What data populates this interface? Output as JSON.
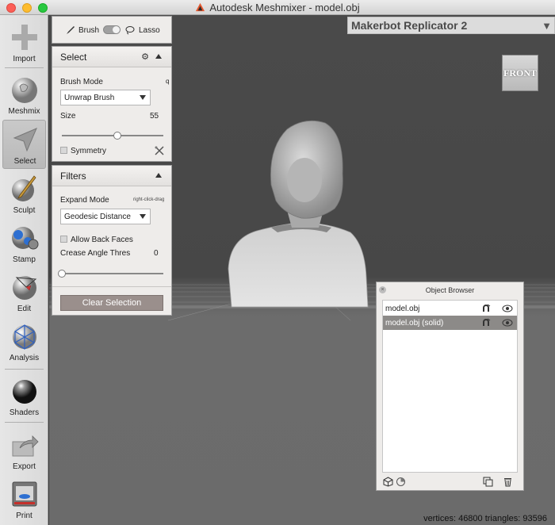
{
  "window": {
    "title": "Autodesk Meshmixer - model.obj"
  },
  "toolbar": {
    "items": [
      {
        "label": "Import",
        "icon": "plus-icon"
      },
      {
        "label": "Meshmix",
        "icon": "meshmix-bunny-icon"
      },
      {
        "label": "Select",
        "icon": "select-arrow-icon",
        "active": true
      },
      {
        "label": "Sculpt",
        "icon": "sculpt-brush-icon"
      },
      {
        "label": "Stamp",
        "icon": "stamp-icon"
      },
      {
        "label": "Edit",
        "icon": "edit-sphere-icon"
      },
      {
        "label": "Analysis",
        "icon": "analysis-sphere-icon"
      },
      {
        "label": "Shaders",
        "icon": "shaders-sphere-icon"
      },
      {
        "label": "Export",
        "icon": "export-icon"
      },
      {
        "label": "Print",
        "icon": "printer-icon"
      }
    ]
  },
  "mode_toggle": {
    "brush_label": "Brush",
    "lasso_label": "Lasso"
  },
  "select_panel": {
    "title": "Select",
    "brush_mode_label": "Brush Mode",
    "brush_mode_hotkey": "q",
    "brush_mode_value": "Unwrap Brush",
    "size_label": "Size",
    "size_value": "55",
    "size_fraction": 0.55,
    "symmetry_label": "Symmetry",
    "symmetry_checked": false
  },
  "filters_panel": {
    "title": "Filters",
    "expand_mode_label": "Expand Mode",
    "expand_mode_hint": "right-click-drag",
    "expand_mode_value": "Geodesic Distance",
    "allow_back_faces_label": "Allow Back Faces",
    "allow_back_faces_checked": false,
    "crease_angle_label": "Crease Angle Thres",
    "crease_angle_value": "0",
    "crease_angle_fraction": 0.0
  },
  "clear_selection_label": "Clear Selection",
  "viewport": {
    "printer": "Makerbot Replicator 2",
    "viewcube_face": "FRONT",
    "status": "vertices: 46800 triangles: 93596"
  },
  "object_browser": {
    "title": "Object Browser",
    "objects": [
      {
        "name": "model.obj",
        "selected": false
      },
      {
        "name": "model.obj (solid)",
        "selected": true
      }
    ]
  },
  "colors": {
    "panel_bg": "#eeecea",
    "viewport_bg": "#4a4a4a",
    "selection_row": "#8c8a88",
    "clear_button": "#9a8f8c"
  }
}
